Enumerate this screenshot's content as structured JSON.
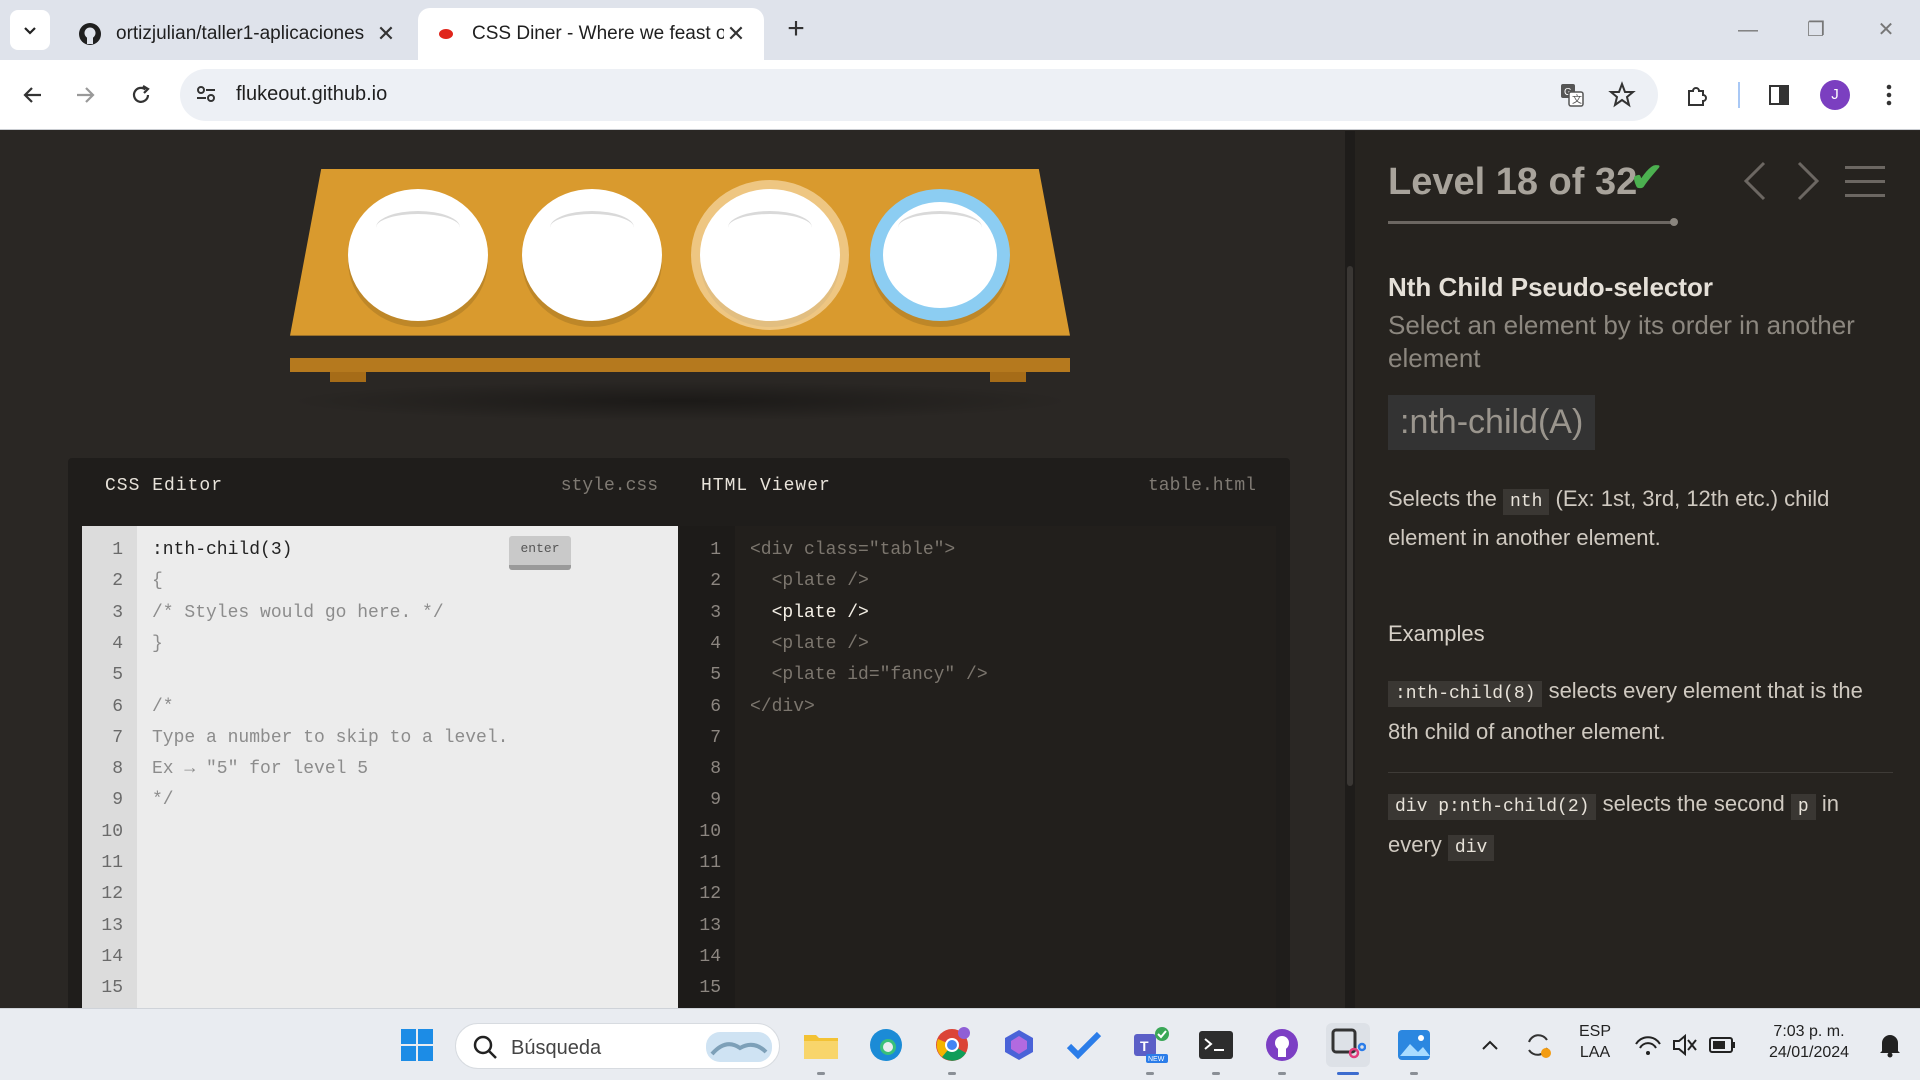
{
  "browser": {
    "tabs": [
      {
        "title": "ortizjulian/taller1-aplicaciones",
        "close": "✕"
      },
      {
        "title": "CSS Diner - Where we feast on CSS",
        "close": "✕"
      }
    ],
    "new_tab": "+",
    "url": "flukeout.github.io",
    "profile_initial": "J",
    "window_controls": {
      "minimize": "—",
      "restore": "❐",
      "close": "✕"
    }
  },
  "game": {
    "level_title": "Level 18 of 32",
    "level_check": "✔",
    "css_editor": {
      "title": "CSS Editor",
      "file": "style.css",
      "enter_label": "enter",
      "line_numbers": [
        "1",
        "2",
        "3",
        "4",
        "5",
        "6",
        "7",
        "8",
        "9",
        "10",
        "11",
        "12",
        "13",
        "14",
        "15"
      ],
      "lines": [
        ":nth-child(3)",
        "{",
        "/* Styles would go here. */",
        "}",
        "",
        "/*",
        "Type a number to skip to a level.",
        "Ex → \"5\" for level 5",
        "*/"
      ]
    },
    "html_viewer": {
      "title": "HTML Viewer",
      "file": "table.html",
      "line_numbers": [
        "1",
        "2",
        "3",
        "4",
        "5",
        "6",
        "7",
        "8",
        "9",
        "10",
        "11",
        "12",
        "13",
        "14",
        "15"
      ],
      "lines": [
        "<div class=\"table\">",
        "  <plate />",
        "  <plate />",
        "  <plate />",
        "  <plate id=\"fancy\" />",
        "</div>"
      ]
    },
    "instructions": {
      "selector_name": "Nth Child Pseudo-selector",
      "title": "Select an element by its order in another element",
      "syntax": ":nth-child(A)",
      "hint_before": "Selects the",
      "hint_tag": "nth",
      "hint_after": "(Ex: 1st, 3rd, 12th etc.) child element in another element.",
      "examples_heading": "Examples",
      "examples": [
        {
          "code": ":nth-child(8)",
          "text": "selects every element that is the 8th child of another element."
        },
        {
          "code": "div p:nth-child(2)",
          "text_1": "selects the second",
          "code_2": "p",
          "text_2": "in every",
          "code_3": "div"
        }
      ]
    }
  },
  "taskbar": {
    "search_placeholder": "Búsqueda",
    "language": "ESP",
    "layout": "LAA",
    "time": "7:03 p. m.",
    "date": "24/01/2024"
  },
  "colors": {
    "table": "#d99a2e",
    "fancy_plate_ring": "#8ccdf2",
    "check_green": "#4cb050",
    "page_bg": "#2a2724"
  }
}
